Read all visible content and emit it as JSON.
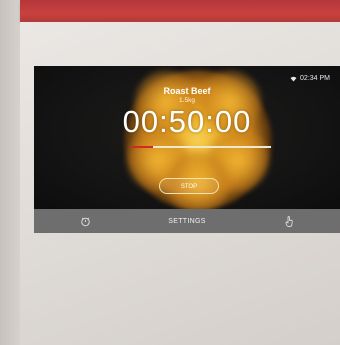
{
  "screen": {
    "status_time": "02:34 PM",
    "recipe_title": "Roast Beef",
    "recipe_subtitle": "1.5kg",
    "timer": "00:50:00",
    "progress_fraction": 0.16,
    "stop_label": "STOP"
  },
  "bottom_bar": {
    "left_icon": "timer-icon",
    "settings_label": "SETTINGS",
    "right_icon": "hand-icon"
  },
  "colors": {
    "accent_red": "#c9413f",
    "glow_amber": "#e9a822",
    "progress_red": "#d22a20",
    "bar_gray": "#6e6e6e"
  }
}
